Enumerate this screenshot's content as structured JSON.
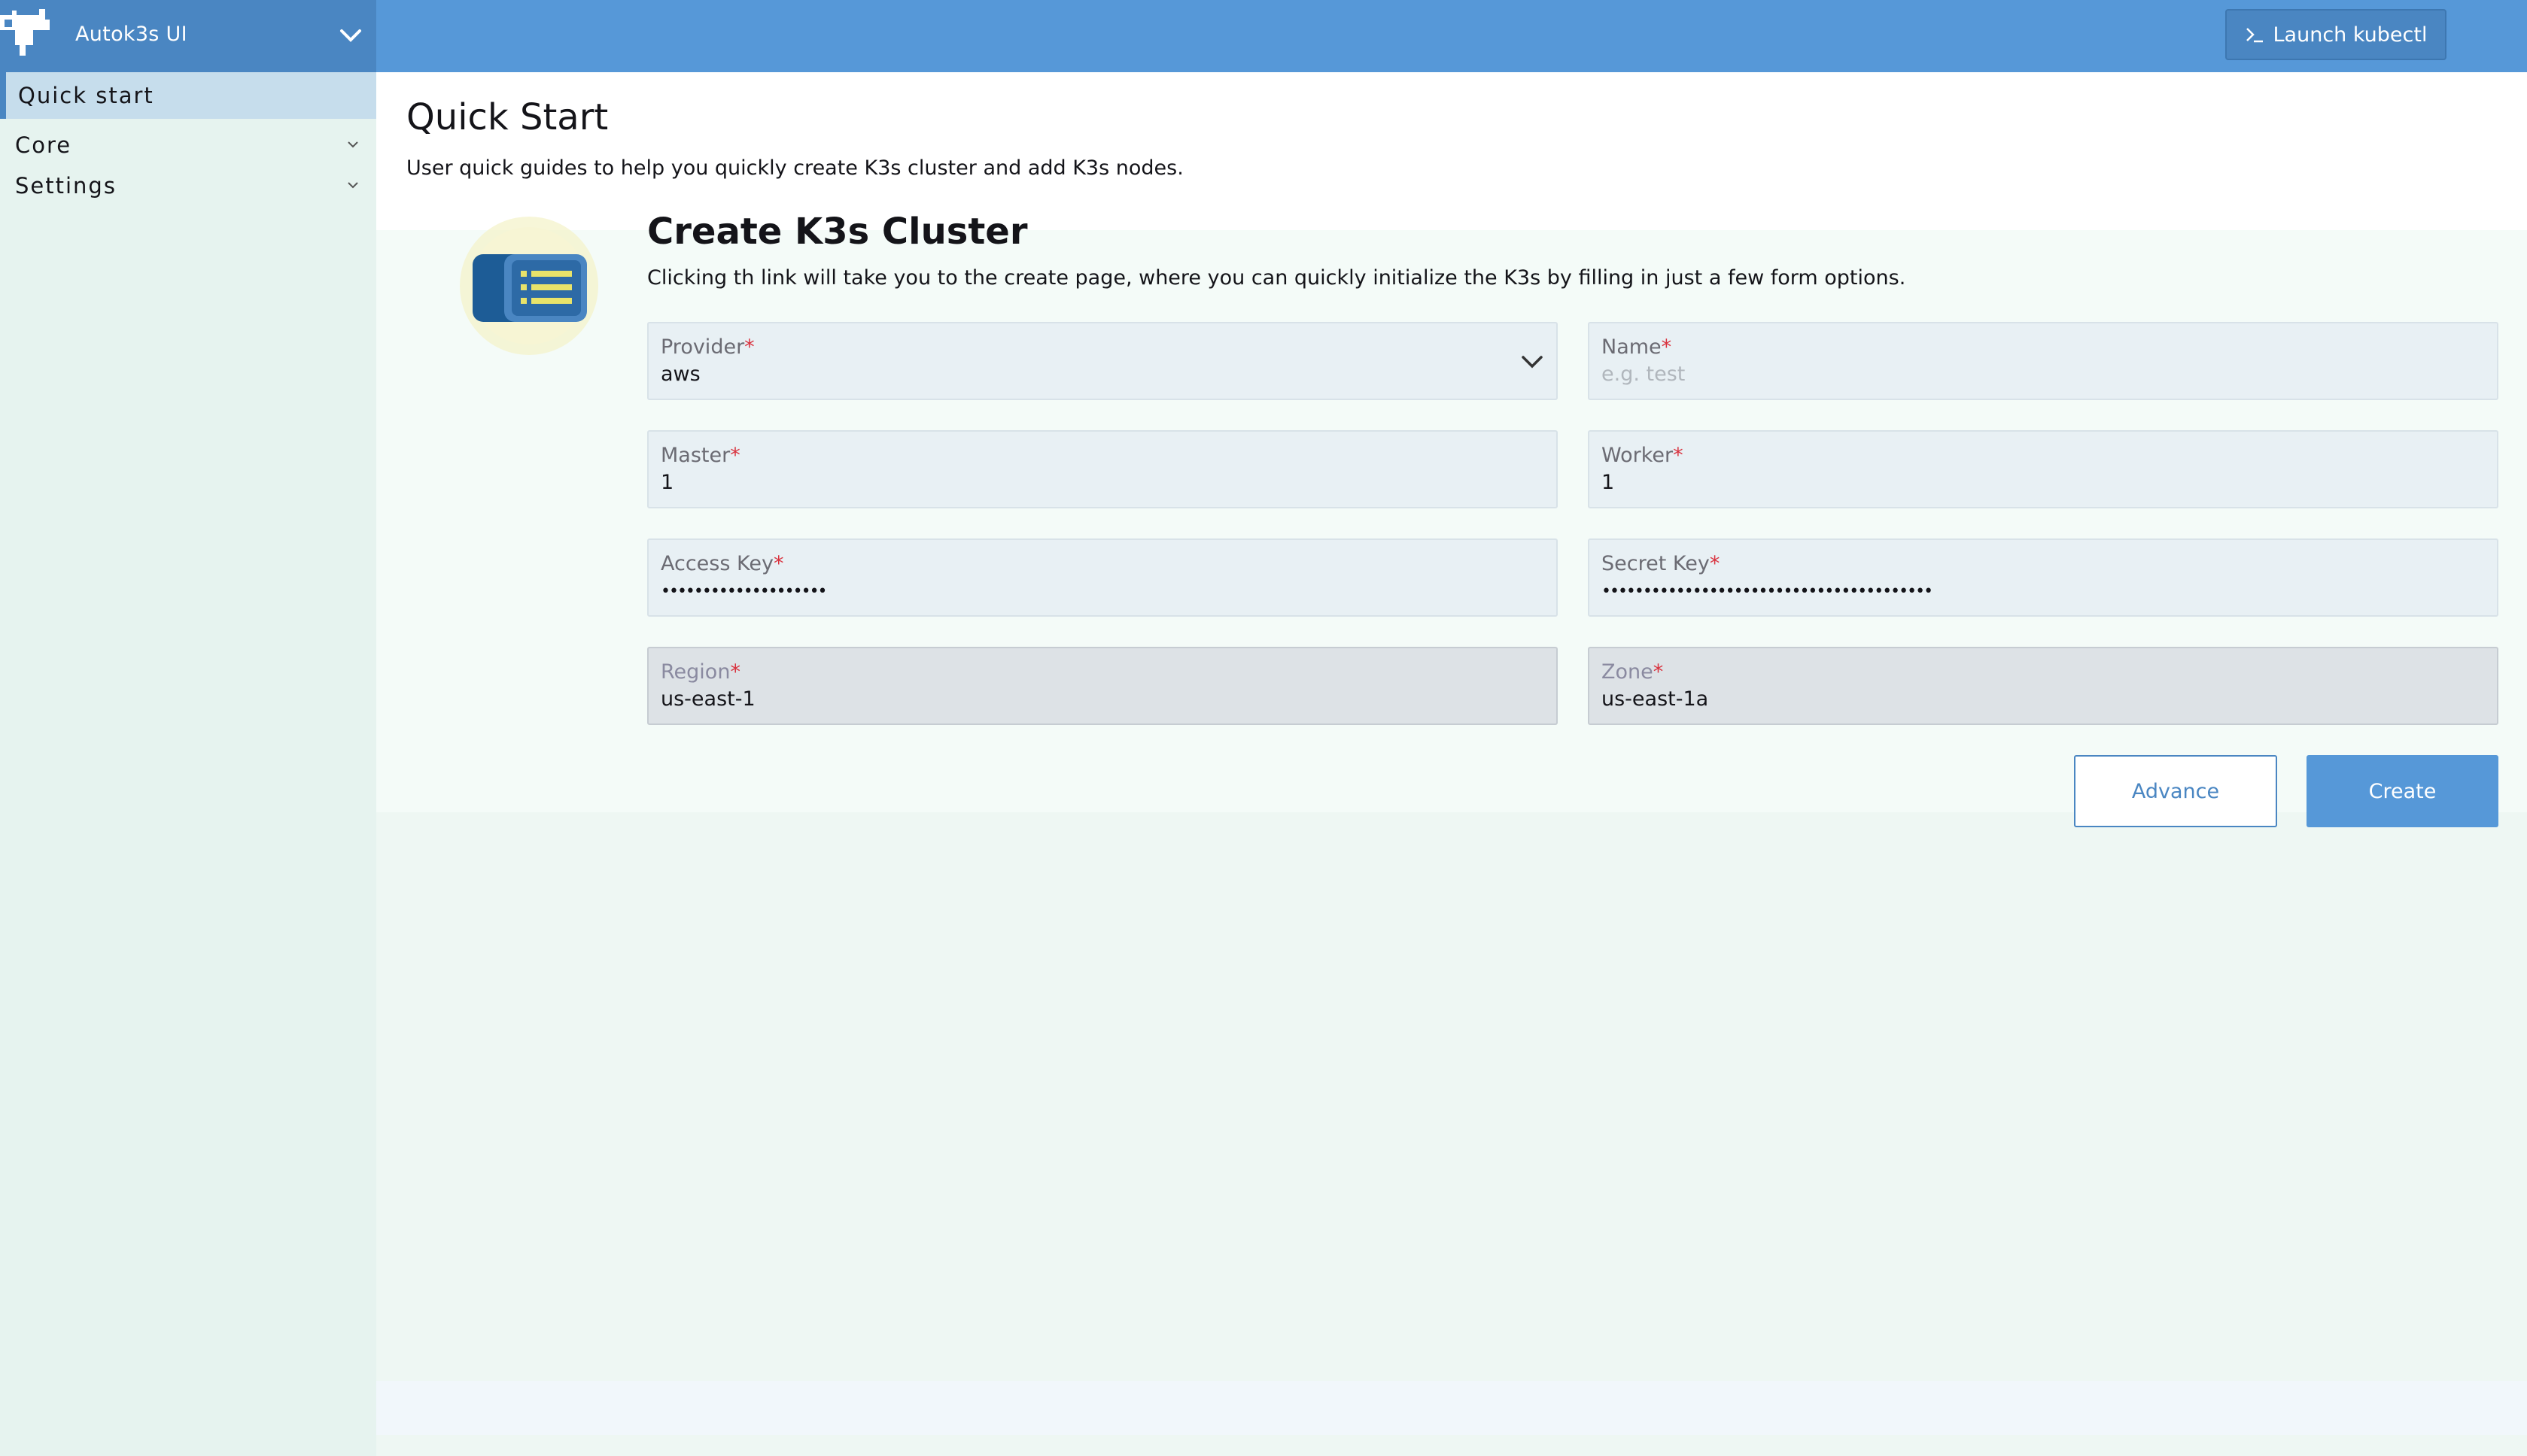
{
  "app": {
    "title": "Autok3s UI",
    "launch_button": "Launch kubectl"
  },
  "sidebar": {
    "items": [
      {
        "label": "Quick start",
        "active": true
      },
      {
        "label": "Core",
        "expandable": true
      },
      {
        "label": "Settings",
        "expandable": true
      }
    ]
  },
  "page": {
    "title": "Quick Start",
    "subtitle": "User quick guides to help you quickly create K3s cluster and add K3s nodes."
  },
  "card": {
    "title": "Create K3s Cluster",
    "description": "Clicking th link will take you to the create page, where you can quickly initialize the K3s by filling in just a few form options."
  },
  "form": {
    "provider": {
      "label": "Provider",
      "value": "aws"
    },
    "name": {
      "label": "Name",
      "value": "",
      "placeholder": "e.g. test"
    },
    "master": {
      "label": "Master",
      "value": "1"
    },
    "worker": {
      "label": "Worker",
      "value": "1"
    },
    "access_key": {
      "label": "Access Key",
      "value": "••••••••••••••••••••"
    },
    "secret_key": {
      "label": "Secret Key",
      "value": "••••••••••••••••••••••••••••••••••••••••"
    },
    "region": {
      "label": "Region",
      "value": "us-east-1"
    },
    "zone": {
      "label": "Zone",
      "value": "us-east-1a"
    },
    "required_mark": "*"
  },
  "actions": {
    "advance": "Advance",
    "create": "Create"
  },
  "icons": {
    "logo": "autok3s-logo-icon",
    "header_dropdown": "chevron-down-icon",
    "launch": "terminal-icon",
    "card_illustration": "list-icon"
  },
  "colors": {
    "header": "#5698d8",
    "brand": "#4a86c2",
    "sidebar": "#e6f3ef",
    "active_nav": "#c6ddec",
    "required": "#d9333f",
    "primary_button": "#5698d8"
  }
}
